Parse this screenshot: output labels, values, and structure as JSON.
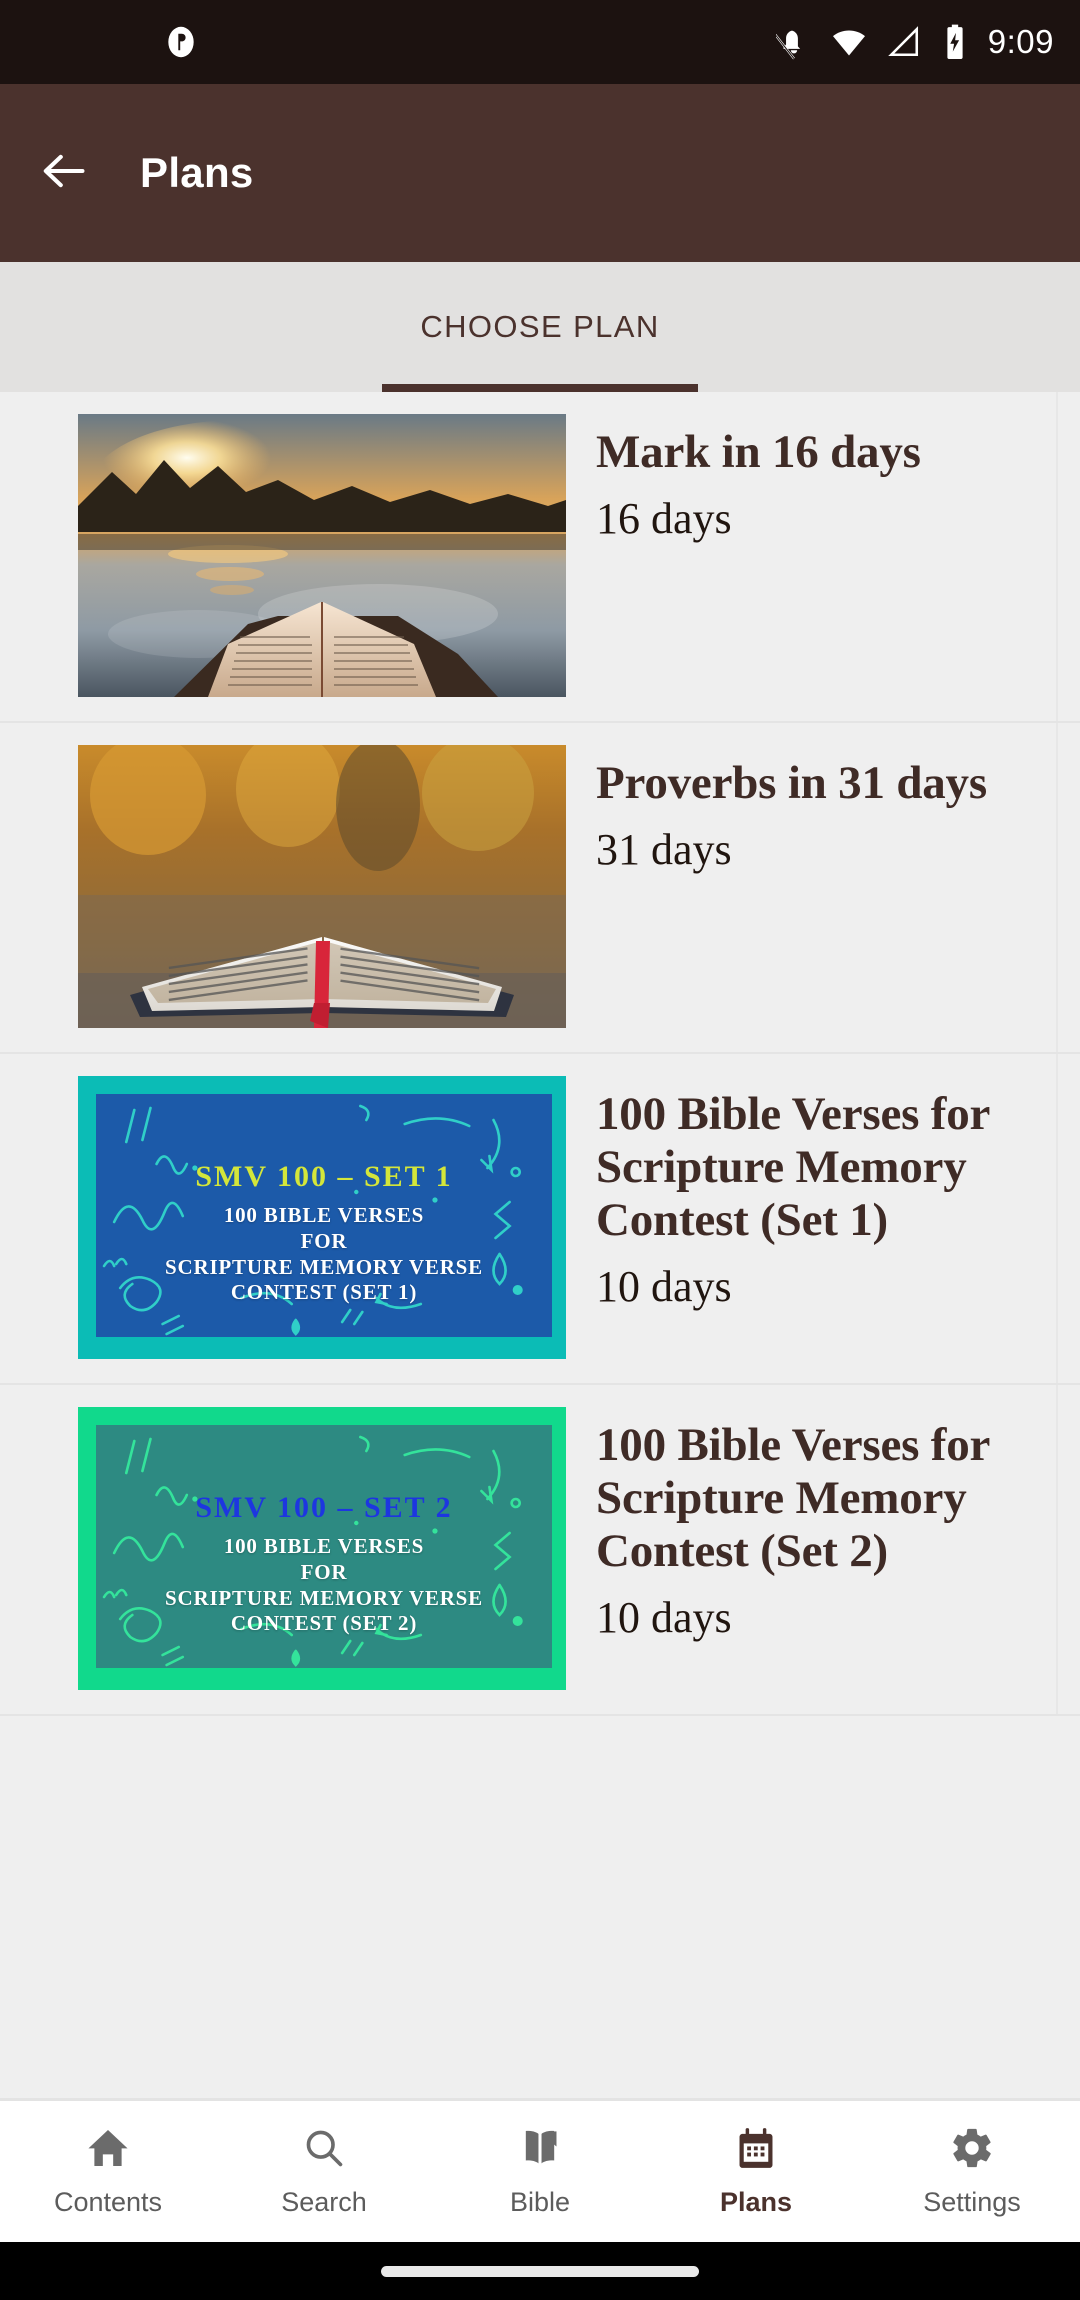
{
  "status_bar": {
    "time": "9:09",
    "icons": [
      "app-notification-icon",
      "notifications-off-icon",
      "wifi-icon",
      "cellular-signal-icon",
      "battery-charging-icon"
    ]
  },
  "app_bar": {
    "back_icon": "back-arrow-icon",
    "title": "Plans"
  },
  "tabs": [
    {
      "label": "CHOOSE PLAN",
      "active": true
    }
  ],
  "plans": [
    {
      "title": "Mark in 16 days",
      "days": "16 days",
      "thumbnail": "sunset-lake-open-bible-photo"
    },
    {
      "title": "Proverbs in 31 days",
      "days": "31 days",
      "thumbnail": "autumn-open-bible-photo"
    },
    {
      "title": "100 Bible Verses for Scripture Memory Contest (Set 1)",
      "days": "10 days",
      "thumbnail": "smv-100-set-1-poster",
      "poster": {
        "heading": "SMV 100 – SET 1",
        "line1": "100 BIBLE VERSES",
        "line2": "FOR",
        "line3": "SCRIPTURE MEMORY VERSE",
        "line4": "CONTEST (SET 1)",
        "border_color": "#0bbcb6",
        "fill_color": "#1c5aa9",
        "heading_color": "#d4e63a",
        "doodle_color": "#30cfc8"
      }
    },
    {
      "title": "100 Bible Verses for Scripture Memory Contest (Set 2)",
      "days": "10 days",
      "thumbnail": "smv-100-set-2-poster",
      "poster": {
        "heading": "SMV 100 – SET 2",
        "line1": "100 BIBLE VERSES",
        "line2": "FOR",
        "line3": "SCRIPTURE MEMORY VERSE",
        "line4": "CONTEST (SET 2)",
        "border_color": "#11d98c",
        "fill_color": "#2d8a82",
        "heading_color": "#1d36e0",
        "doodle_color": "#34e39b"
      }
    }
  ],
  "bottom_nav": [
    {
      "label": "Contents",
      "icon": "home-icon",
      "active": false
    },
    {
      "label": "Search",
      "icon": "search-icon",
      "active": false
    },
    {
      "label": "Bible",
      "icon": "open-book-icon",
      "active": false
    },
    {
      "label": "Plans",
      "icon": "calendar-icon",
      "active": true
    },
    {
      "label": "Settings",
      "icon": "gear-icon",
      "active": false
    }
  ],
  "colors": {
    "app_bar": "#4b322d",
    "status_bar": "#1c1210",
    "tab_strip": "#e2e1e0",
    "list_background": "#efefef",
    "accent": "#4b322d",
    "title_text": "#3f2b26"
  }
}
